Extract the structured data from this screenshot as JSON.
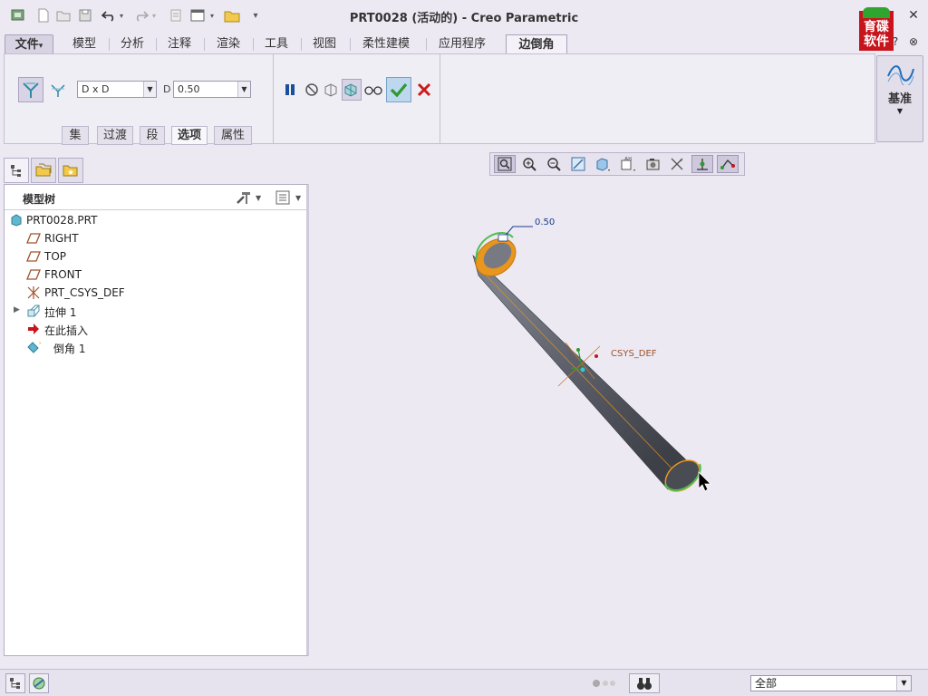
{
  "window": {
    "title": "PRT0028 (活动的) - Creo Parametric"
  },
  "logo": {
    "line1": "育碟",
    "line2": "软件"
  },
  "menu_tabs": [
    {
      "label": "文件",
      "suffix": "▾"
    },
    {
      "label": "模型"
    },
    {
      "label": "分析"
    },
    {
      "label": "注释"
    },
    {
      "label": "渲染"
    },
    {
      "label": "工具"
    },
    {
      "label": "视图"
    },
    {
      "label": "柔性建模"
    },
    {
      "label": "应用程序"
    },
    {
      "label": "边倒角"
    }
  ],
  "ribbon": {
    "dimension_scheme": "D x D",
    "d_label": "D",
    "d_value": "0.50",
    "subtabs": [
      "集",
      "过渡",
      "段",
      "选项",
      "属性"
    ],
    "selected_subtab": "选项",
    "datum_label": "基准"
  },
  "model_tree": {
    "title": "模型树",
    "nodes": [
      {
        "label": "PRT0028.PRT",
        "icon": "part-icon"
      },
      {
        "label": "RIGHT",
        "icon": "datum-plane-icon"
      },
      {
        "label": "TOP",
        "icon": "datum-plane-icon"
      },
      {
        "label": "FRONT",
        "icon": "datum-plane-icon"
      },
      {
        "label": "PRT_CSYS_DEF",
        "icon": "csys-icon"
      },
      {
        "label": "拉伸 1",
        "icon": "extrude-icon"
      },
      {
        "label": "在此插入",
        "icon": "insert-here-arrow-icon"
      },
      {
        "label": "倒角 1",
        "icon": "chamfer-icon"
      }
    ]
  },
  "graphics": {
    "dimension_value": "0.50",
    "csys_label": "CSYS_DEF"
  },
  "status": {
    "filter_value": "全部"
  },
  "colors": {
    "accept": "#2d9a2d",
    "cancel": "#cc1b1b",
    "chamfer_highlight": "#e8961e",
    "cylinder_body": "#5c5f69"
  }
}
